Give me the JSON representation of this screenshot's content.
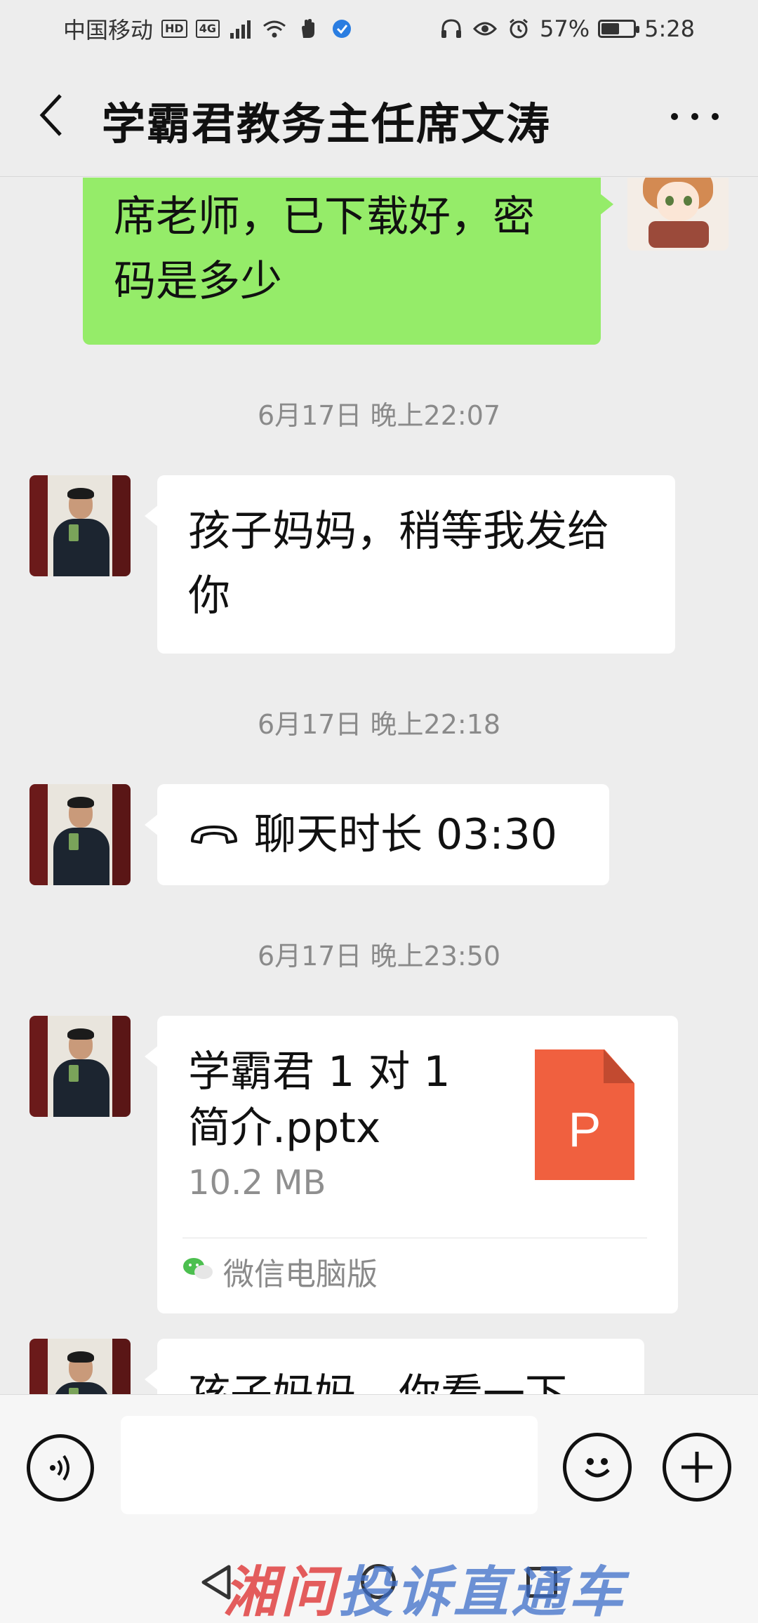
{
  "status_bar": {
    "carrier": "中国移动",
    "hd_badge": "HD",
    "network_badge": "4G",
    "battery": "57%",
    "battery_level": 0.57,
    "time": "5:28"
  },
  "header": {
    "title": "学霸君教务主任席文涛"
  },
  "messages": {
    "m1": {
      "text": "席老师，已下载好，密码是多少",
      "side": "right"
    },
    "t1": "6月17日 晚上22:07",
    "m2": {
      "text": "孩子妈妈，稍等我发给你",
      "side": "left"
    },
    "t2": "6月17日 晚上22:18",
    "m3": {
      "text": "聊天时长 03:30",
      "side": "left",
      "icon": "phone-hangup-icon"
    },
    "t3": "6月17日 晚上23:50",
    "m4": {
      "file_name": "学霸君 1 对 1 简介.pptx",
      "file_size": "10.2 MB",
      "file_icon_letter": "P",
      "file_icon_color": "#f0603f",
      "source": "微信电脑版",
      "side": "left"
    },
    "m5": {
      "text": "孩子妈妈，你看一下",
      "side": "left"
    }
  },
  "input_bar": {
    "placeholder": ""
  },
  "watermark": {
    "part1": "湘问",
    "part2": "投诉直通车"
  },
  "colors": {
    "self_bubble": "#95ec69",
    "other_bubble": "#ffffff",
    "background": "#ededed"
  }
}
